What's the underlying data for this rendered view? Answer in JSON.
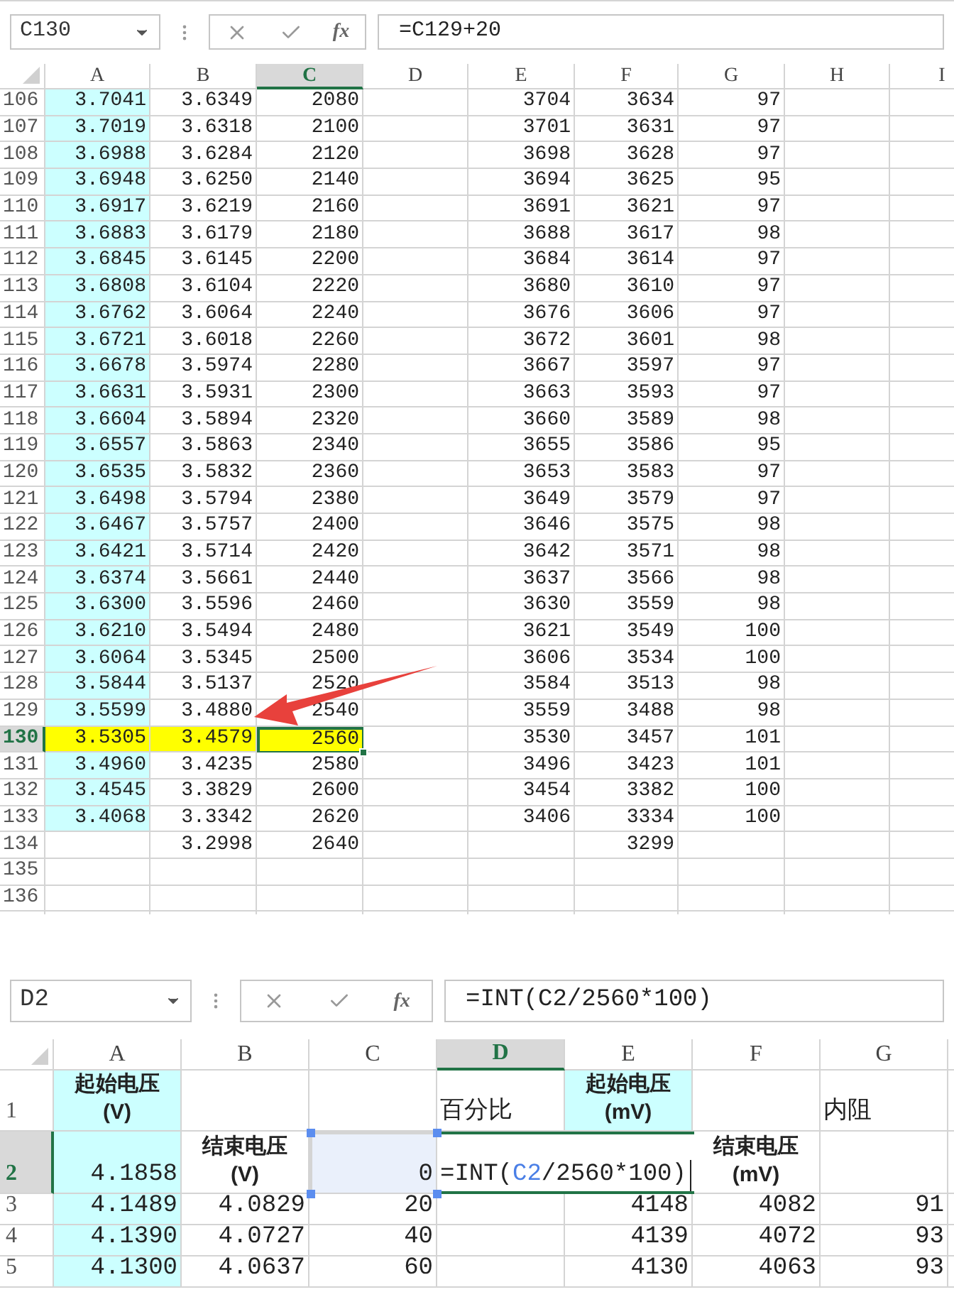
{
  "top_sheet": {
    "formula_bar": {
      "name_box": "C130",
      "function_label": "fx",
      "formula": "=C129+20"
    },
    "columns": [
      {
        "label": "A",
        "selected": false
      },
      {
        "label": "B",
        "selected": false
      },
      {
        "label": "C",
        "selected": true
      },
      {
        "label": "D",
        "selected": false
      },
      {
        "label": "E",
        "selected": false
      },
      {
        "label": "F",
        "selected": false
      },
      {
        "label": "G",
        "selected": false
      },
      {
        "label": "H",
        "selected": false
      },
      {
        "label": "I",
        "selected": false
      }
    ],
    "rows": [
      {
        "header": "106",
        "selected": false,
        "marked": false,
        "cells": [
          "3.7041",
          "3.6349",
          "2080",
          "",
          "3704",
          "3634",
          "97",
          "",
          ""
        ]
      },
      {
        "header": "107",
        "selected": false,
        "marked": false,
        "cells": [
          "3.7019",
          "3.6318",
          "2100",
          "",
          "3701",
          "3631",
          "97",
          "",
          ""
        ]
      },
      {
        "header": "108",
        "selected": false,
        "marked": false,
        "cells": [
          "3.6988",
          "3.6284",
          "2120",
          "",
          "3698",
          "3628",
          "97",
          "",
          ""
        ]
      },
      {
        "header": "109",
        "selected": false,
        "marked": false,
        "cells": [
          "3.6948",
          "3.6250",
          "2140",
          "",
          "3694",
          "3625",
          "95",
          "",
          ""
        ]
      },
      {
        "header": "110",
        "selected": false,
        "marked": false,
        "cells": [
          "3.6917",
          "3.6219",
          "2160",
          "",
          "3691",
          "3621",
          "97",
          "",
          ""
        ]
      },
      {
        "header": "111",
        "selected": false,
        "marked": false,
        "cells": [
          "3.6883",
          "3.6179",
          "2180",
          "",
          "3688",
          "3617",
          "98",
          "",
          ""
        ]
      },
      {
        "header": "112",
        "selected": false,
        "marked": false,
        "cells": [
          "3.6845",
          "3.6145",
          "2200",
          "",
          "3684",
          "3614",
          "97",
          "",
          ""
        ]
      },
      {
        "header": "113",
        "selected": false,
        "marked": false,
        "cells": [
          "3.6808",
          "3.6104",
          "2220",
          "",
          "3680",
          "3610",
          "97",
          "",
          ""
        ]
      },
      {
        "header": "114",
        "selected": false,
        "marked": false,
        "cells": [
          "3.6762",
          "3.6064",
          "2240",
          "",
          "3676",
          "3606",
          "97",
          "",
          ""
        ]
      },
      {
        "header": "115",
        "selected": false,
        "marked": false,
        "cells": [
          "3.6721",
          "3.6018",
          "2260",
          "",
          "3672",
          "3601",
          "98",
          "",
          ""
        ]
      },
      {
        "header": "116",
        "selected": false,
        "marked": false,
        "cells": [
          "3.6678",
          "3.5974",
          "2280",
          "",
          "3667",
          "3597",
          "97",
          "",
          ""
        ]
      },
      {
        "header": "117",
        "selected": false,
        "marked": false,
        "cells": [
          "3.6631",
          "3.5931",
          "2300",
          "",
          "3663",
          "3593",
          "97",
          "",
          ""
        ]
      },
      {
        "header": "118",
        "selected": false,
        "marked": false,
        "cells": [
          "3.6604",
          "3.5894",
          "2320",
          "",
          "3660",
          "3589",
          "98",
          "",
          ""
        ]
      },
      {
        "header": "119",
        "selected": false,
        "marked": false,
        "cells": [
          "3.6557",
          "3.5863",
          "2340",
          "",
          "3655",
          "3586",
          "95",
          "",
          ""
        ]
      },
      {
        "header": "120",
        "selected": false,
        "marked": false,
        "cells": [
          "3.6535",
          "3.5832",
          "2360",
          "",
          "3653",
          "3583",
          "97",
          "",
          ""
        ]
      },
      {
        "header": "121",
        "selected": false,
        "marked": false,
        "cells": [
          "3.6498",
          "3.5794",
          "2380",
          "",
          "3649",
          "3579",
          "97",
          "",
          ""
        ]
      },
      {
        "header": "122",
        "selected": false,
        "marked": false,
        "cells": [
          "3.6467",
          "3.5757",
          "2400",
          "",
          "3646",
          "3575",
          "98",
          "",
          ""
        ]
      },
      {
        "header": "123",
        "selected": false,
        "marked": false,
        "cells": [
          "3.6421",
          "3.5714",
          "2420",
          "",
          "3642",
          "3571",
          "98",
          "",
          ""
        ]
      },
      {
        "header": "124",
        "selected": false,
        "marked": false,
        "cells": [
          "3.6374",
          "3.5661",
          "2440",
          "",
          "3637",
          "3566",
          "98",
          "",
          ""
        ]
      },
      {
        "header": "125",
        "selected": false,
        "marked": false,
        "cells": [
          "3.6300",
          "3.5596",
          "2460",
          "",
          "3630",
          "3559",
          "98",
          "",
          ""
        ]
      },
      {
        "header": "126",
        "selected": false,
        "marked": false,
        "cells": [
          "3.6210",
          "3.5494",
          "2480",
          "",
          "3621",
          "3549",
          "100",
          "",
          ""
        ]
      },
      {
        "header": "127",
        "selected": false,
        "marked": false,
        "cells": [
          "3.6064",
          "3.5345",
          "2500",
          "",
          "3606",
          "3534",
          "100",
          "",
          ""
        ]
      },
      {
        "header": "128",
        "selected": false,
        "marked": false,
        "cells": [
          "3.5844",
          "3.5137",
          "2520",
          "",
          "3584",
          "3513",
          "98",
          "",
          ""
        ]
      },
      {
        "header": "129",
        "selected": false,
        "marked": false,
        "cells": [
          "3.5599",
          "3.4880",
          "2540",
          "",
          "3559",
          "3488",
          "98",
          "",
          ""
        ]
      },
      {
        "header": "130",
        "selected": true,
        "marked": true,
        "cells": [
          "3.5305",
          "3.4579",
          "2560",
          "",
          "3530",
          "3457",
          "101",
          "",
          ""
        ]
      },
      {
        "header": "131",
        "selected": false,
        "marked": false,
        "cells": [
          "3.4960",
          "3.4235",
          "2580",
          "",
          "3496",
          "3423",
          "101",
          "",
          ""
        ]
      },
      {
        "header": "132",
        "selected": false,
        "marked": false,
        "cells": [
          "3.4545",
          "3.3829",
          "2600",
          "",
          "3454",
          "3382",
          "100",
          "",
          ""
        ]
      },
      {
        "header": "133",
        "selected": false,
        "marked": false,
        "cells": [
          "3.4068",
          "3.3342",
          "2620",
          "",
          "3406",
          "3334",
          "100",
          "",
          ""
        ]
      },
      {
        "header": "134",
        "selected": false,
        "marked": false,
        "cells": [
          "",
          "3.2998",
          "2640",
          "",
          "",
          "3299",
          "",
          "",
          ""
        ]
      },
      {
        "header": "135",
        "selected": false,
        "marked": false,
        "cells": [
          "",
          "",
          "",
          "",
          "",
          "",
          "",
          "",
          ""
        ]
      },
      {
        "header": "136",
        "selected": false,
        "marked": false,
        "cells": [
          "",
          "",
          "",
          "",
          "",
          "",
          "",
          "",
          ""
        ]
      }
    ]
  },
  "bottom_sheet": {
    "formula_bar": {
      "name_box": "D2",
      "function_label": "fx",
      "formula": "=INT(C2/2560*100)"
    },
    "columns": [
      {
        "label": "A",
        "selected": false
      },
      {
        "label": "B",
        "selected": false
      },
      {
        "label": "C",
        "selected": false
      },
      {
        "label": "D",
        "selected": true
      },
      {
        "label": "E",
        "selected": false
      },
      {
        "label": "F",
        "selected": false
      },
      {
        "label": "G",
        "selected": false
      }
    ],
    "rows": [
      {
        "header": "1",
        "selected": false,
        "cells": [
          {
            "kind": "heading",
            "text": "起始电压\n(V)",
            "shaded": true
          },
          {
            "kind": "empty",
            "shaded": false
          },
          {
            "kind": "empty",
            "shaded": false
          },
          {
            "kind": "label",
            "text": "百分比",
            "shaded": false
          },
          {
            "kind": "heading",
            "text": "起始电压\n(mV)",
            "shaded": true
          },
          {
            "kind": "empty",
            "shaded": false
          },
          {
            "kind": "label",
            "text": "内阻",
            "shaded": false
          }
        ]
      },
      {
        "header": "2",
        "selected": true,
        "cells": [
          {
            "kind": "number",
            "text": "4.1858",
            "shaded": true
          },
          {
            "kind": "heading",
            "text": "结束电压\n(V)",
            "shaded": false
          },
          {
            "kind": "reference",
            "text": "0",
            "shaded": false
          },
          {
            "kind": "editor",
            "before": "=INT(",
            "reference": "C2",
            "after": "/2560*100)",
            "shaded": false
          },
          {
            "kind": "empty"
          },
          {
            "kind": "heading",
            "text": "结束电压\n(mV)",
            "shaded": false
          },
          {
            "kind": "empty",
            "shaded": false
          }
        ]
      },
      {
        "header": "3",
        "selected": false,
        "cells": [
          {
            "kind": "number",
            "text": "4.1489",
            "shaded": true
          },
          {
            "kind": "number",
            "text": "4.0829",
            "shaded": false
          },
          {
            "kind": "number",
            "text": "20",
            "shaded": false
          },
          {
            "kind": "empty",
            "shaded": false
          },
          {
            "kind": "number",
            "text": "4148",
            "shaded": false
          },
          {
            "kind": "number",
            "text": "4082",
            "shaded": false
          },
          {
            "kind": "number",
            "text": "91",
            "shaded": false
          }
        ]
      },
      {
        "header": "4",
        "selected": false,
        "cells": [
          {
            "kind": "number",
            "text": "4.1390",
            "shaded": true
          },
          {
            "kind": "number",
            "text": "4.0727",
            "shaded": false
          },
          {
            "kind": "number",
            "text": "40",
            "shaded": false
          },
          {
            "kind": "empty",
            "shaded": false
          },
          {
            "kind": "number",
            "text": "4139",
            "shaded": false
          },
          {
            "kind": "number",
            "text": "4072",
            "shaded": false
          },
          {
            "kind": "number",
            "text": "93",
            "shaded": false
          }
        ]
      },
      {
        "header": "5",
        "selected": false,
        "cells": [
          {
            "kind": "number",
            "text": "4.1300",
            "shaded": true
          },
          {
            "kind": "number",
            "text": "4.0637",
            "shaded": false
          },
          {
            "kind": "number",
            "text": "60",
            "shaded": false
          },
          {
            "kind": "empty",
            "shaded": false
          },
          {
            "kind": "number",
            "text": "4130",
            "shaded": false
          },
          {
            "kind": "number",
            "text": "4063",
            "shaded": false
          },
          {
            "kind": "number",
            "text": "93",
            "shaded": false
          }
        ]
      }
    ]
  }
}
